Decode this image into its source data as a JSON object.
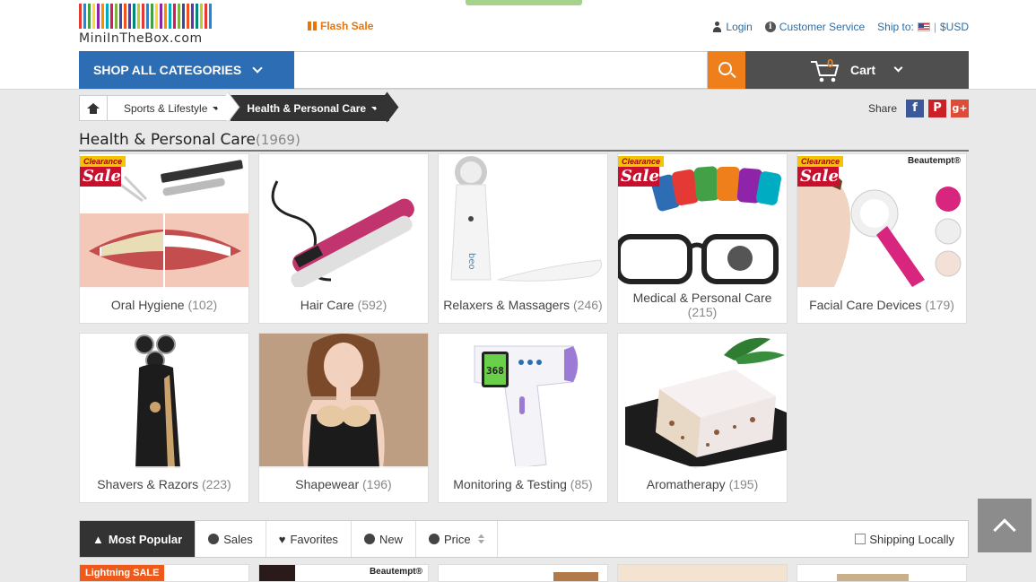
{
  "header": {
    "logo_text": "MiniInTheBox.com",
    "flash_sale": "Flash Sale",
    "login": "Login",
    "customer_service": "Customer Service",
    "ship_to": "Ship to:",
    "currency": "$USD"
  },
  "nav": {
    "shop_all": "SHOP ALL CATEGORIES",
    "search_placeholder": "",
    "cart_count": "0",
    "cart_label": "Cart"
  },
  "breadcrumb": {
    "level1": "Sports & Lifestyle",
    "level2": "Health & Personal Care"
  },
  "share": {
    "label": "Share",
    "facebook": "f",
    "pinterest": "P",
    "googleplus": "g+"
  },
  "page": {
    "title": "Health & Personal Care",
    "count": "(1969)"
  },
  "categories": [
    {
      "label": "Oral Hygiene",
      "count": "(102)",
      "badge": "sale"
    },
    {
      "label": "Hair Care",
      "count": "(592)"
    },
    {
      "label": "Relaxers & Massagers",
      "count": "(246)"
    },
    {
      "label": "Medical & Personal Care",
      "count": "(215)",
      "badge": "sale"
    },
    {
      "label": "Facial Care Devices",
      "count": "(179)",
      "badge": "sale",
      "brand": "Beautempt®"
    },
    {
      "label": "Shavers & Razors",
      "count": "(223)"
    },
    {
      "label": "Shapewear",
      "count": "(196)"
    },
    {
      "label": "Monitoring & Testing",
      "count": "(85)"
    },
    {
      "label": "Aromatherapy",
      "count": "(195)"
    }
  ],
  "badges": {
    "clearance": "Clearance",
    "sale": "Sale"
  },
  "sortbar": {
    "most_popular": "Most Popular",
    "sales": "Sales",
    "favorites": "Favorites",
    "new": "New",
    "price": "Price",
    "shipping_locally": "Shipping Locally"
  },
  "preview": {
    "lightning": "Lightning SALE",
    "brand": "Beautempt®"
  },
  "colors": {
    "primary": "#2c6db3",
    "accent": "#ef7f1a",
    "dark": "#333333",
    "cart_bar": "#4f4f4f"
  }
}
